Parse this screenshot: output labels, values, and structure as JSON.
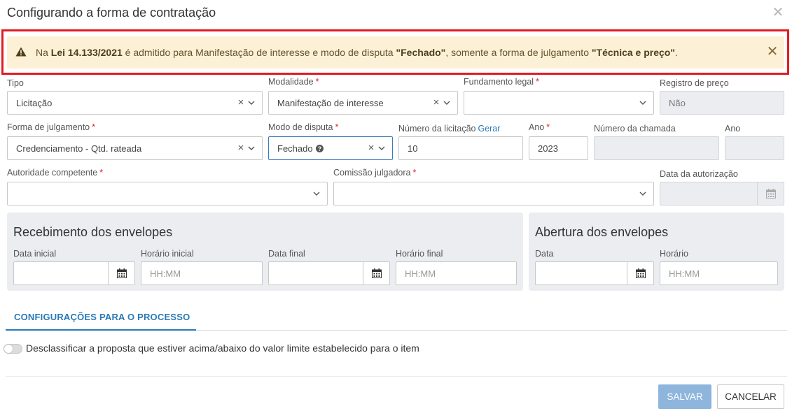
{
  "modal": {
    "title": "Configurando a forma de contratação",
    "close_icon": "close-icon"
  },
  "alert": {
    "icon": "warning-icon",
    "text_1": "Na ",
    "law": "Lei 14.133/2021",
    "text_2": " é admitido para Manifestação de interesse e modo de disputa ",
    "mode": "\"Fechado\"",
    "text_3": ", somente a forma de julgamento ",
    "judgement": "\"Técnica e preço\"",
    "text_4": ".",
    "background": "#fcf1d6",
    "highlight_border": "#e31b23"
  },
  "form": {
    "tipo": {
      "label": "Tipo",
      "value": "Licitação"
    },
    "modalidade": {
      "label": "Modalidade",
      "required": "*",
      "value": "Manifestação de interesse"
    },
    "fundamento": {
      "label": "Fundamento legal",
      "required": "*",
      "value": ""
    },
    "registro": {
      "label": "Registro de preço",
      "value": "Não"
    },
    "forma_julgamento": {
      "label": "Forma de julgamento",
      "required": "*",
      "value": "Credenciamento - Qtd. rateada"
    },
    "modo_disputa": {
      "label": "Modo de disputa",
      "required": "*",
      "value": "Fechado",
      "help_icon": "question-circle-icon"
    },
    "numero_licitacao": {
      "label": "Número da licitação",
      "link": "Gerar",
      "value": "10"
    },
    "ano": {
      "label": "Ano",
      "required": "*",
      "value": "2023"
    },
    "numero_chamada": {
      "label": "Número da chamada",
      "value": ""
    },
    "ano_chamada": {
      "label": "Ano",
      "value": ""
    },
    "autoridade": {
      "label": "Autoridade competente",
      "required": "*",
      "value": ""
    },
    "comissao": {
      "label": "Comissão julgadora",
      "required": "*",
      "value": ""
    },
    "data_autorizacao": {
      "label": "Data da autorização",
      "value": ""
    }
  },
  "recebimento": {
    "title": "Recebimento dos envelopes",
    "data_inicial": {
      "label": "Data inicial",
      "value": ""
    },
    "horario_inicial": {
      "label": "Horário inicial",
      "placeholder": "HH:MM"
    },
    "data_final": {
      "label": "Data final",
      "value": ""
    },
    "horario_final": {
      "label": "Horário final",
      "placeholder": "HH:MM"
    }
  },
  "abertura": {
    "title": "Abertura dos envelopes",
    "data": {
      "label": "Data",
      "value": ""
    },
    "horario": {
      "label": "Horário",
      "placeholder": "HH:MM"
    }
  },
  "tabs": [
    {
      "label": "CONFIGURAÇÕES PARA O PROCESSO",
      "active": true
    }
  ],
  "settings": {
    "desclassificar": {
      "label": "Desclassificar a proposta que estiver acima/abaixo do valor limite estabelecido para o item",
      "enabled": false
    }
  },
  "footer": {
    "save_label": "SALVAR",
    "cancel_label": "CANCELAR"
  },
  "colors": {
    "accent": "#2a7ab8",
    "required": "#e31b23",
    "save_button": "#8eb5dc"
  }
}
